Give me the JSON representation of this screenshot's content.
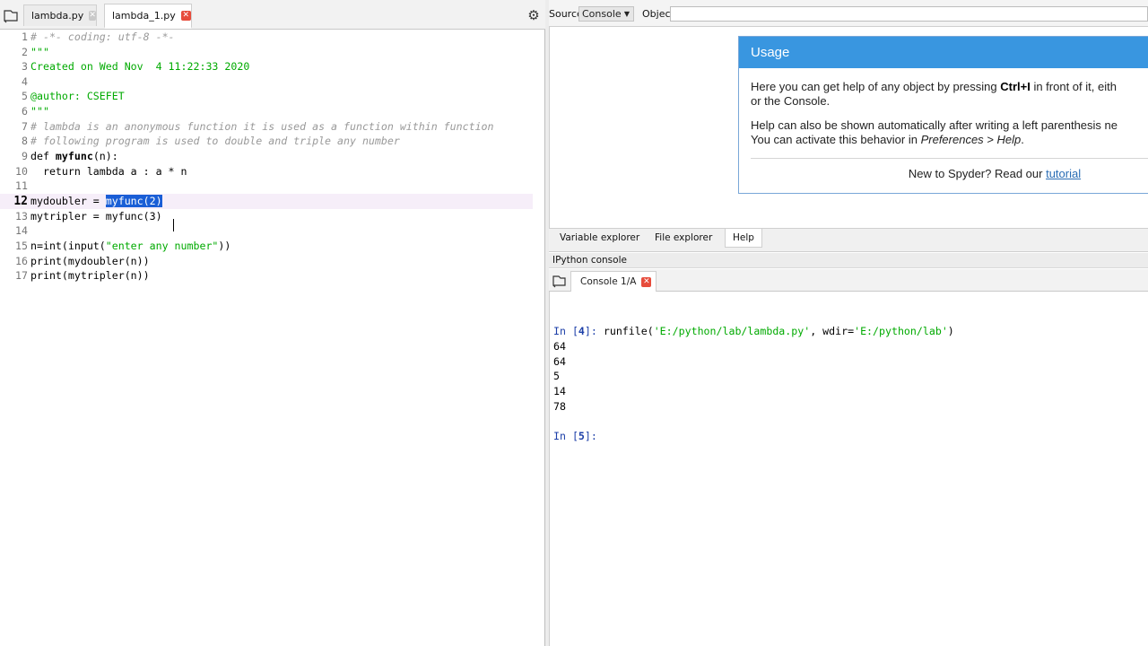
{
  "editor": {
    "tabs": [
      {
        "label": "lambda.py",
        "active": false
      },
      {
        "label": "lambda_1.py",
        "active": true
      }
    ],
    "lines": [
      {
        "num": "1",
        "text": "# -*- coding: utf-8 -*-"
      },
      {
        "num": "2",
        "text": "\"\"\""
      },
      {
        "num": "3",
        "text": "Created on Wed Nov  4 11:22:33 2020"
      },
      {
        "num": "4",
        "text": ""
      },
      {
        "num": "5",
        "text": "@author: CSEFET"
      },
      {
        "num": "6",
        "text": "\"\"\""
      },
      {
        "num": "7",
        "text": "# lambda is an anonymous function it is used as a function within function"
      },
      {
        "num": "8",
        "text": "# following program is used to double and triple any number"
      },
      {
        "num": "9",
        "text_a": "def ",
        "text_b": "myfunc",
        "text_c": "(n):"
      },
      {
        "num": "10",
        "text": "  return lambda a : a * n"
      },
      {
        "num": "11",
        "text": ""
      },
      {
        "num": "12",
        "text_a": "mydoubler = ",
        "text_b": "myfunc(2)"
      },
      {
        "num": "13",
        "text": "mytripler = myfunc(3)"
      },
      {
        "num": "14",
        "text": ""
      },
      {
        "num": "15",
        "text_a": "n=int(input(",
        "text_b": "\"enter any number\"",
        "text_c": "))"
      },
      {
        "num": "16",
        "text": "print(mydoubler(n))"
      },
      {
        "num": "17",
        "text": "print(mytripler(n))"
      }
    ]
  },
  "help": {
    "source_label": "Source",
    "source_value": "Console",
    "object_label": "Object",
    "usage_title": "Usage",
    "para1_a": "Here you can get help of any object by pressing ",
    "para1_key": "Ctrl+I",
    "para1_b": " in front of it, eith",
    "para1_line2": "or the Console.",
    "para2_line1": "Help can also be shown automatically after writing a left parenthesis ne",
    "para2_line2_a": "You can activate this behavior in ",
    "para2_line2_i": "Preferences > Help",
    "para2_line2_b": ".",
    "footer_text": "New to Spyder? Read our ",
    "footer_link": "tutorial",
    "tabs": [
      "Variable explorer",
      "File explorer",
      "Help"
    ]
  },
  "console": {
    "header": "IPython console",
    "tab_label": "Console 1/A",
    "in4_prefix": "In [",
    "in4_num": "4",
    "in4_suffix": "]: ",
    "in4_cmd_a": "runfile(",
    "in4_str1": "'E:/python/lab/lambda.py'",
    "in4_cmd_b": ", wdir=",
    "in4_str2": "'E:/python/lab'",
    "in4_cmd_c": ")",
    "outputs": [
      "64",
      "64",
      "5",
      "14",
      "78"
    ],
    "in5_prefix": "In [",
    "in5_num": "5",
    "in5_suffix": "]:"
  },
  "colors": {
    "selection": "#1a5ed6",
    "usage_header": "#3996e0",
    "close_active": "#e74c3c",
    "string": "#00aa00",
    "prompt": "#1c3fa8"
  }
}
